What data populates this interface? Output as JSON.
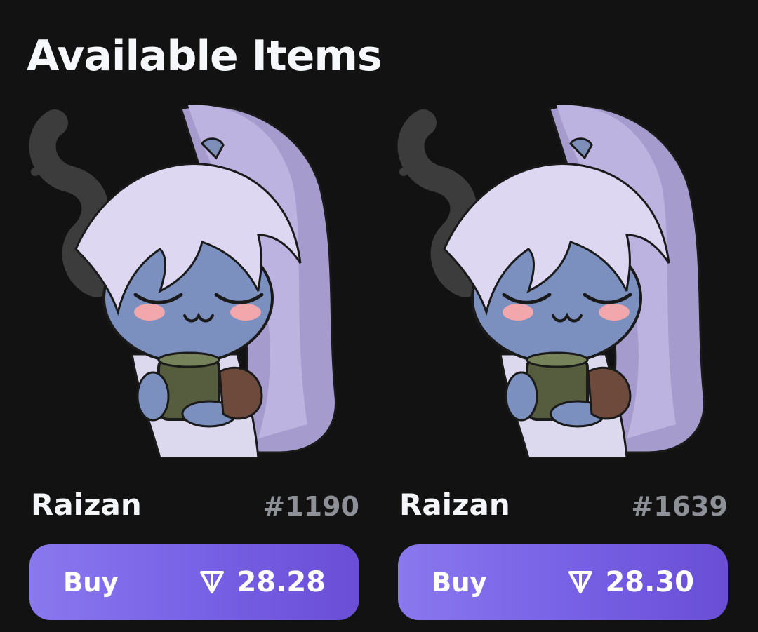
{
  "header": {
    "title": "Available Items"
  },
  "items": [
    {
      "name": "Raizan",
      "number": "#1190",
      "buy_label": "Buy",
      "price": "28.28",
      "currency_icon": "ton-icon"
    },
    {
      "name": "Raizan",
      "number": "#1639",
      "buy_label": "Buy",
      "price": "28.30",
      "currency_icon": "ton-icon"
    }
  ],
  "colors": {
    "background": "#121212",
    "button_start": "#8a78ee",
    "button_end": "#6a4ed6",
    "number_text": "#8e9098"
  }
}
